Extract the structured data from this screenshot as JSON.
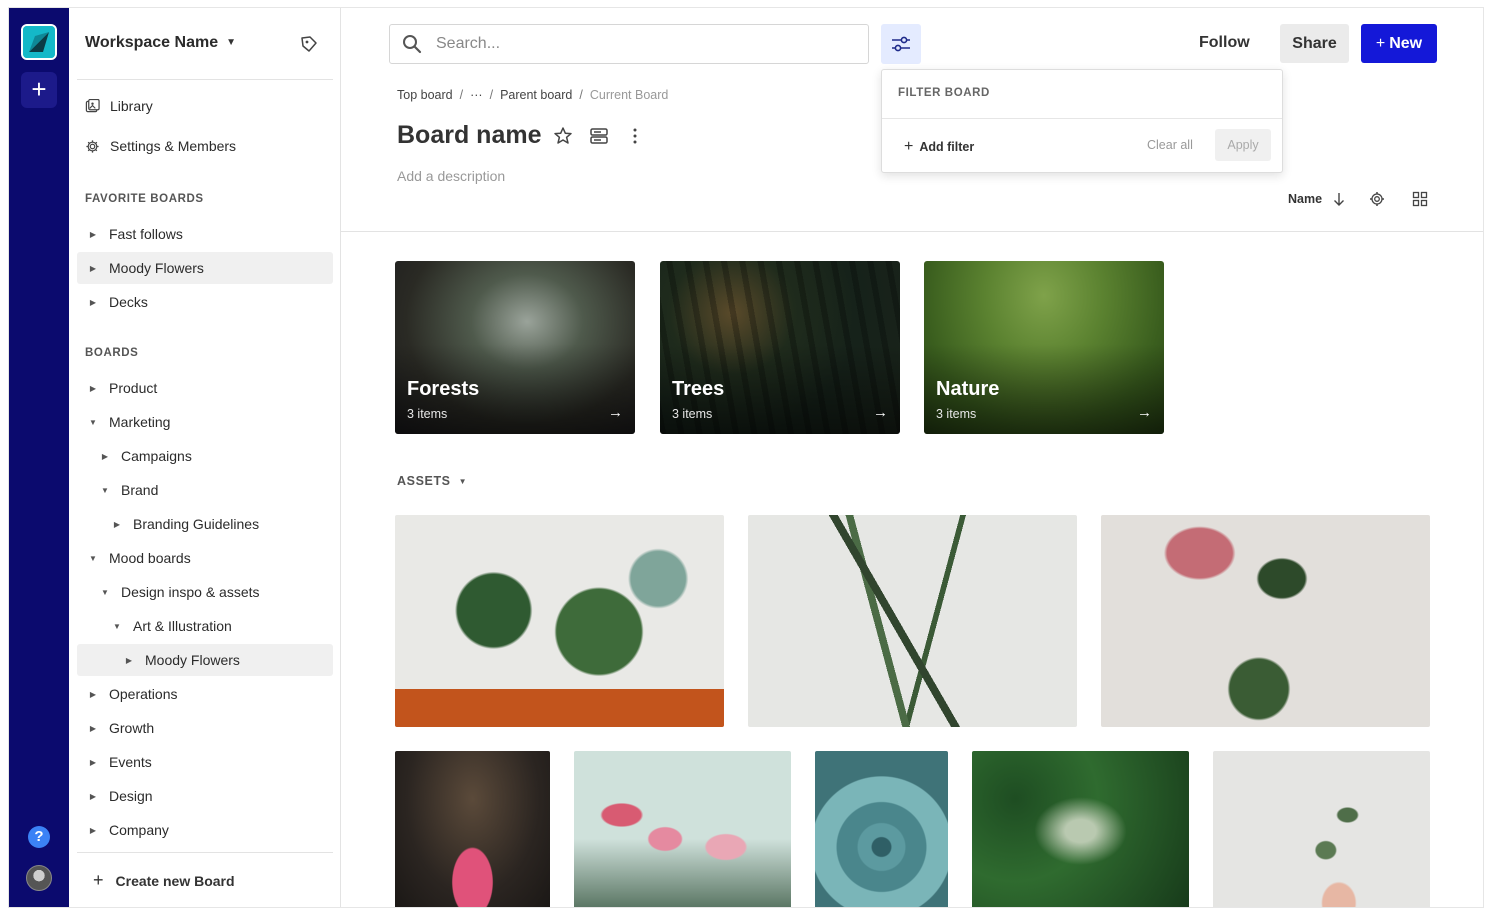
{
  "workspace": {
    "name": "Workspace Name"
  },
  "sidebar": {
    "nav": [
      {
        "label": "Library",
        "icon": "library-icon"
      },
      {
        "label": "Settings & Members",
        "icon": "gear-icon"
      }
    ],
    "favorites_heading": "FAVORITE BOARDS",
    "favorites": [
      {
        "label": "Fast follows",
        "expanded": false,
        "selected": false
      },
      {
        "label": "Moody Flowers",
        "expanded": false,
        "selected": true
      },
      {
        "label": "Decks",
        "expanded": false,
        "selected": false
      }
    ],
    "boards_heading": "BOARDS",
    "boards": [
      {
        "label": "Product",
        "depth": 0,
        "expanded": false,
        "selected": false
      },
      {
        "label": "Marketing",
        "depth": 0,
        "expanded": true,
        "selected": false
      },
      {
        "label": "Campaigns",
        "depth": 1,
        "expanded": false,
        "selected": false
      },
      {
        "label": "Brand",
        "depth": 1,
        "expanded": true,
        "selected": false
      },
      {
        "label": "Branding Guidelines",
        "depth": 2,
        "expanded": false,
        "selected": false
      },
      {
        "label": "Mood boards",
        "depth": 0,
        "expanded": true,
        "selected": false
      },
      {
        "label": "Design inspo & assets",
        "depth": 1,
        "expanded": true,
        "selected": false
      },
      {
        "label": "Art & Illustration",
        "depth": 2,
        "expanded": true,
        "selected": false
      },
      {
        "label": "Moody Flowers",
        "depth": 3,
        "expanded": false,
        "selected": true
      },
      {
        "label": "Operations",
        "depth": 0,
        "expanded": false,
        "selected": false
      },
      {
        "label": "Growth",
        "depth": 0,
        "expanded": false,
        "selected": false
      },
      {
        "label": "Events",
        "depth": 0,
        "expanded": false,
        "selected": false
      },
      {
        "label": "Design",
        "depth": 0,
        "expanded": false,
        "selected": false
      },
      {
        "label": "Company",
        "depth": 0,
        "expanded": false,
        "selected": false
      }
    ],
    "create_label": "Create new Board"
  },
  "header": {
    "search_placeholder": "Search...",
    "follow_label": "Follow",
    "share_label": "Share",
    "new_label": "New",
    "accent": "#1418d8"
  },
  "breadcrumb": [
    "Top board",
    "···",
    "Parent board",
    "Current Board"
  ],
  "board": {
    "name": "Board name",
    "description_placeholder": "Add a description",
    "sort_label": "Name"
  },
  "filter_popover": {
    "title": "FILTER BOARD",
    "add_label": "Add filter",
    "clear_label": "Clear all",
    "apply_label": "Apply"
  },
  "sub_boards": [
    {
      "title": "Forests",
      "count": "3 items"
    },
    {
      "title": "Trees",
      "count": "3 items"
    },
    {
      "title": "Nature",
      "count": "3 items"
    }
  ],
  "assets_heading": "ASSETS"
}
